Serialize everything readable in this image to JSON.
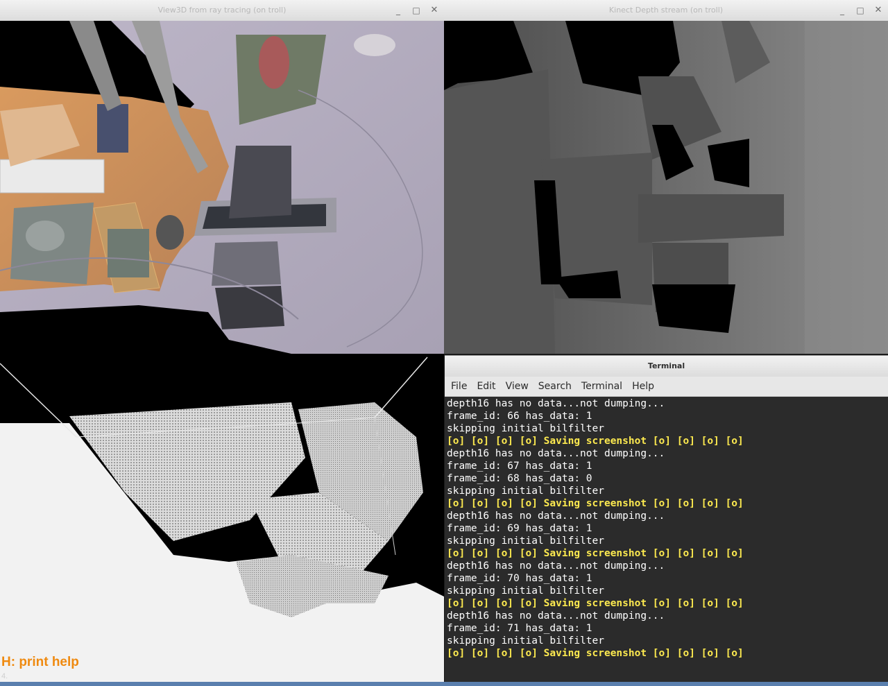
{
  "windows": {
    "view3d": {
      "title": "View3D from ray tracing (on troll)"
    },
    "kinect": {
      "title": "Kinect Depth stream (on troll)"
    },
    "cloud": {
      "help_text": "H: print help",
      "small_text": "4."
    },
    "terminal": {
      "title": "Terminal",
      "menu": [
        "File",
        "Edit",
        "View",
        "Search",
        "Terminal",
        "Help"
      ],
      "lines": [
        {
          "text": "depth16 has no data...not dumping...",
          "hl": false
        },
        {
          "text": "frame_id: 66 has_data: 1",
          "hl": false
        },
        {
          "text": "skipping initial bilfilter",
          "hl": false
        },
        {
          "text": "[o] [o] [o] [o] Saving screenshot [o] [o] [o] [o]",
          "hl": true
        },
        {
          "text": "depth16 has no data...not dumping...",
          "hl": false
        },
        {
          "text": "frame_id: 67 has_data: 1",
          "hl": false
        },
        {
          "text": "frame_id: 68 has_data: 0",
          "hl": false
        },
        {
          "text": "skipping initial bilfilter",
          "hl": false
        },
        {
          "text": "[o] [o] [o] [o] Saving screenshot [o] [o] [o] [o]",
          "hl": true
        },
        {
          "text": "depth16 has no data...not dumping...",
          "hl": false
        },
        {
          "text": "frame_id: 69 has_data: 1",
          "hl": false
        },
        {
          "text": "skipping initial bilfilter",
          "hl": false
        },
        {
          "text": "[o] [o] [o] [o] Saving screenshot [o] [o] [o] [o]",
          "hl": true
        },
        {
          "text": "depth16 has no data...not dumping...",
          "hl": false
        },
        {
          "text": "frame_id: 70 has_data: 1",
          "hl": false
        },
        {
          "text": "skipping initial bilfilter",
          "hl": false
        },
        {
          "text": "[o] [o] [o] [o] Saving screenshot [o] [o] [o] [o]",
          "hl": true
        },
        {
          "text": "depth16 has no data...not dumping...",
          "hl": false
        },
        {
          "text": "frame_id: 71 has_data: 1",
          "hl": false
        },
        {
          "text": "skipping initial bilfilter",
          "hl": false
        },
        {
          "text": "[o] [o] [o] [o] Saving screenshot [o] [o] [o] [o]",
          "hl": true
        }
      ]
    }
  },
  "window_controls": {
    "minimize": "_",
    "maximize": "□",
    "close": "✕"
  },
  "colors": {
    "terminal_bg": "#2b2b2b",
    "highlight": "#fce94f",
    "help_text": "#ef8a10"
  }
}
